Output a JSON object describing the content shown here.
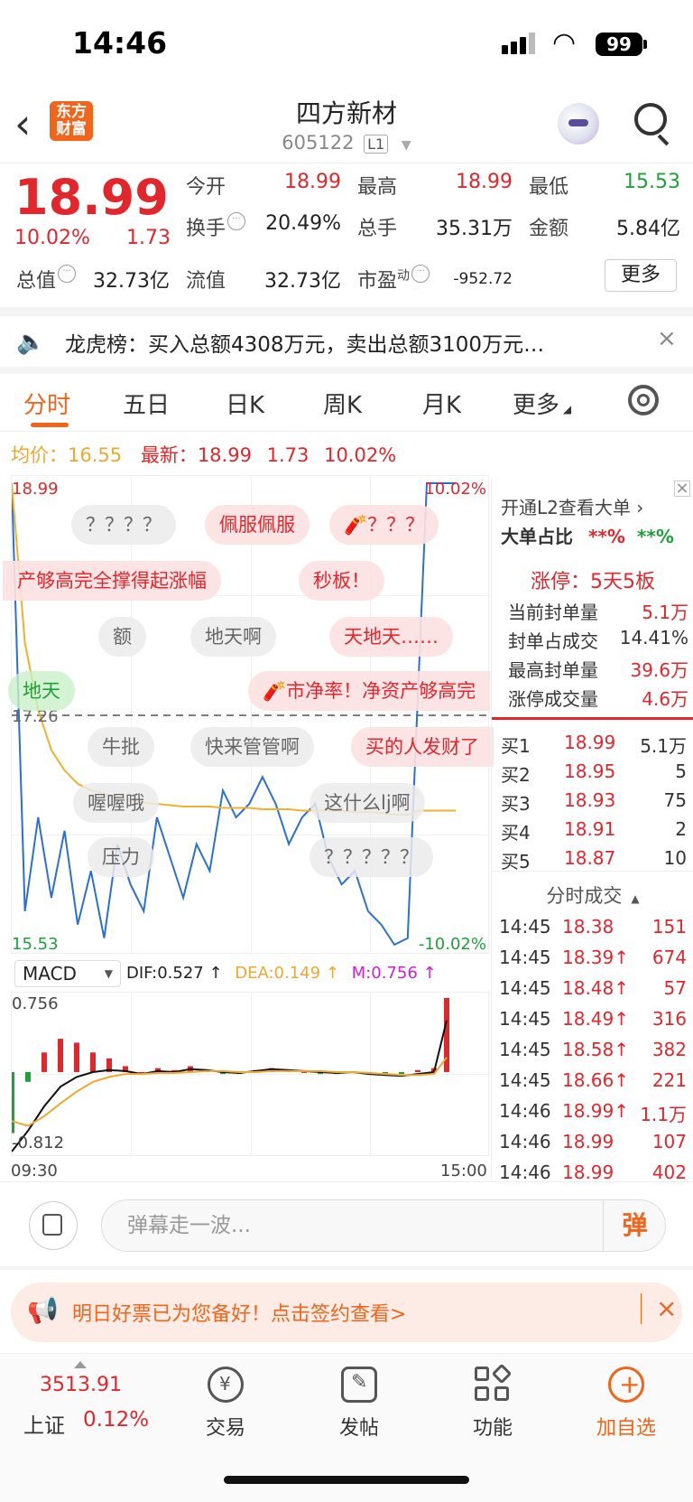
{
  "status": {
    "time": "14:46",
    "battery": "99"
  },
  "header": {
    "back": "‹",
    "logo_line1": "东方",
    "logo_line2": "财富",
    "name": "四方新材",
    "code": "605122",
    "level": "L1"
  },
  "quote": {
    "price": "18.99",
    "change_pct": "10.02%",
    "change": "1.73",
    "open_label": "今开",
    "open": "18.99",
    "high_label": "最高",
    "high": "18.99",
    "low_label": "最低",
    "low": "15.53",
    "turnover_label": "换手",
    "turnover": "20.49%",
    "volume_label": "总手",
    "volume": "35.31万",
    "amount_label": "金额",
    "amount": "5.84亿",
    "mktcap_label": "总值",
    "mktcap": "32.73亿",
    "float_label": "流值",
    "float": "32.73亿",
    "pe_label": "市盈",
    "pe_sup": "动",
    "pe": "-952.72",
    "more": "更多"
  },
  "longhu": {
    "text": "龙虎榜：买入总额4308万元，卖出总额3100万元…",
    "close": "×"
  },
  "tabs": [
    {
      "label": "分时"
    },
    {
      "label": "五日"
    },
    {
      "label": "日K"
    },
    {
      "label": "周K"
    },
    {
      "label": "月K"
    },
    {
      "label": "更多"
    }
  ],
  "avg": {
    "avg_label": "均价：",
    "avg": "16.55",
    "last_label": "最新：",
    "last": "18.99",
    "chg": "1.73",
    "pct": "10.02%"
  },
  "chart": {
    "top_price": "18.99",
    "top_pct": "10.02%",
    "bottom_price": "15.53",
    "bottom_pct": "-10.02%",
    "ref_price": "17.26",
    "bubbles": [
      {
        "text": "？？？？"
      },
      {
        "text": "佩服佩服"
      },
      {
        "text": "🧨？？？"
      },
      {
        "text": "产够高完全撑得起涨幅"
      },
      {
        "text": "秒板！"
      },
      {
        "text": "额"
      },
      {
        "text": "地天啊"
      },
      {
        "text": "天地天……"
      },
      {
        "text": "地天"
      },
      {
        "text": "🧨市净率！净资产够高完"
      },
      {
        "text": "牛批"
      },
      {
        "text": "快来管管啊"
      },
      {
        "text": "买的人发财了"
      },
      {
        "text": "喔喔哦"
      },
      {
        "text": "这什么lj啊"
      },
      {
        "text": "压力"
      },
      {
        "text": "？？？？？"
      }
    ]
  },
  "chart_data": {
    "type": "line",
    "series": [
      {
        "name": "price",
        "values": [
          18.99,
          15.8,
          16.5,
          15.9,
          16.4,
          15.7,
          16.1,
          15.6,
          16.3,
          16.0,
          15.8,
          16.5,
          16.2,
          15.9,
          16.3,
          16.1,
          16.7,
          16.5,
          16.6,
          16.8,
          16.6,
          16.3,
          16.5,
          16.6,
          16.2,
          16.0,
          16.1,
          15.8,
          15.7,
          15.55,
          15.6,
          18.99,
          18.99
        ]
      },
      {
        "name": "均价",
        "values": [
          18.99,
          17.8,
          17.3,
          17.0,
          16.85,
          16.75,
          16.7,
          16.68,
          16.65,
          16.63,
          16.61,
          16.6,
          16.59,
          16.58,
          16.58,
          16.58,
          16.57,
          16.57,
          16.57,
          16.56,
          16.56,
          16.56,
          16.55,
          16.55,
          16.55,
          16.55,
          16.54,
          16.54,
          16.53,
          16.52,
          16.52,
          16.55,
          16.55
        ]
      }
    ],
    "ylim": [
      15.53,
      18.99
    ],
    "xlabel": "",
    "ylabel": ""
  },
  "macd": {
    "select": "MACD",
    "dif": "DIF:0.527 ↑",
    "dea": "DEA:0.149 ↑",
    "m": "M:0.756 ↑",
    "top": "0.756",
    "bottom": "-0.812",
    "time_start": "09:30",
    "time_end": "15:00",
    "dif_values": [
      -0.812,
      -0.6,
      -0.35,
      -0.15,
      -0.05,
      0.0,
      0.02,
      0.01,
      -0.02,
      0.01,
      0.0,
      0.03,
      0.02,
      0.0,
      -0.01,
      0.01,
      0.03,
      0.02,
      0.01,
      0.0,
      -0.01,
      0.0,
      -0.02,
      -0.03,
      -0.04,
      -0.02,
      0.0,
      0.527
    ],
    "dea_values": [
      -0.5,
      -0.55,
      -0.45,
      -0.32,
      -0.2,
      -0.1,
      -0.05,
      -0.02,
      -0.02,
      -0.01,
      -0.01,
      0.0,
      0.01,
      0.01,
      0.0,
      0.0,
      0.01,
      0.01,
      0.01,
      0.01,
      0.0,
      0.0,
      -0.01,
      -0.02,
      -0.03,
      -0.03,
      -0.02,
      0.149
    ]
  },
  "rpanel": {
    "l2": "开通L2查看大单 ›",
    "bigorder_label": "大单占比",
    "bigorder_r": "**%",
    "bigorder_g": "**%",
    "limit_title": "涨停：5天5板",
    "limits": [
      {
        "label": "当前封单量",
        "value": "5.1万"
      },
      {
        "label": "封单占成交",
        "value": "14.41%"
      },
      {
        "label": "最高封单量",
        "value": "39.6万"
      },
      {
        "label": "涨停成交量",
        "value": "4.6万"
      }
    ],
    "buys": [
      {
        "label": "买1",
        "price": "18.99",
        "qty": "5.1万"
      },
      {
        "label": "买2",
        "price": "18.95",
        "qty": "5"
      },
      {
        "label": "买3",
        "price": "18.93",
        "qty": "75"
      },
      {
        "label": "买4",
        "price": "18.91",
        "qty": "2"
      },
      {
        "label": "买5",
        "price": "18.87",
        "qty": "10"
      }
    ],
    "ticks_title": "分时成交",
    "ticks": [
      {
        "time": "14:45",
        "price": "18.38",
        "qty": "151"
      },
      {
        "time": "14:45",
        "price": "18.39↑",
        "qty": "674"
      },
      {
        "time": "14:45",
        "price": "18.48↑",
        "qty": "57"
      },
      {
        "time": "14:45",
        "price": "18.49↑",
        "qty": "316"
      },
      {
        "time": "14:45",
        "price": "18.58↑",
        "qty": "382"
      },
      {
        "time": "14:45",
        "price": "18.66↑",
        "qty": "221"
      },
      {
        "time": "14:46",
        "price": "18.99↑",
        "qty": "1.1万"
      },
      {
        "time": "14:46",
        "price": "18.99",
        "qty": "107"
      },
      {
        "time": "14:46",
        "price": "18.99",
        "qty": "402"
      }
    ]
  },
  "danmu": {
    "placeholder": "弹幕走一波...",
    "btn": "弹"
  },
  "promo": {
    "text": "明日好票已为您备好！点击签约查看>",
    "close": "×"
  },
  "bnav": {
    "index_val": "3513.91",
    "index_name": "上证",
    "index_pct": "0.12%",
    "items": [
      {
        "label": "交易"
      },
      {
        "label": "发帖"
      },
      {
        "label": "功能"
      },
      {
        "label": "加自选"
      }
    ]
  }
}
